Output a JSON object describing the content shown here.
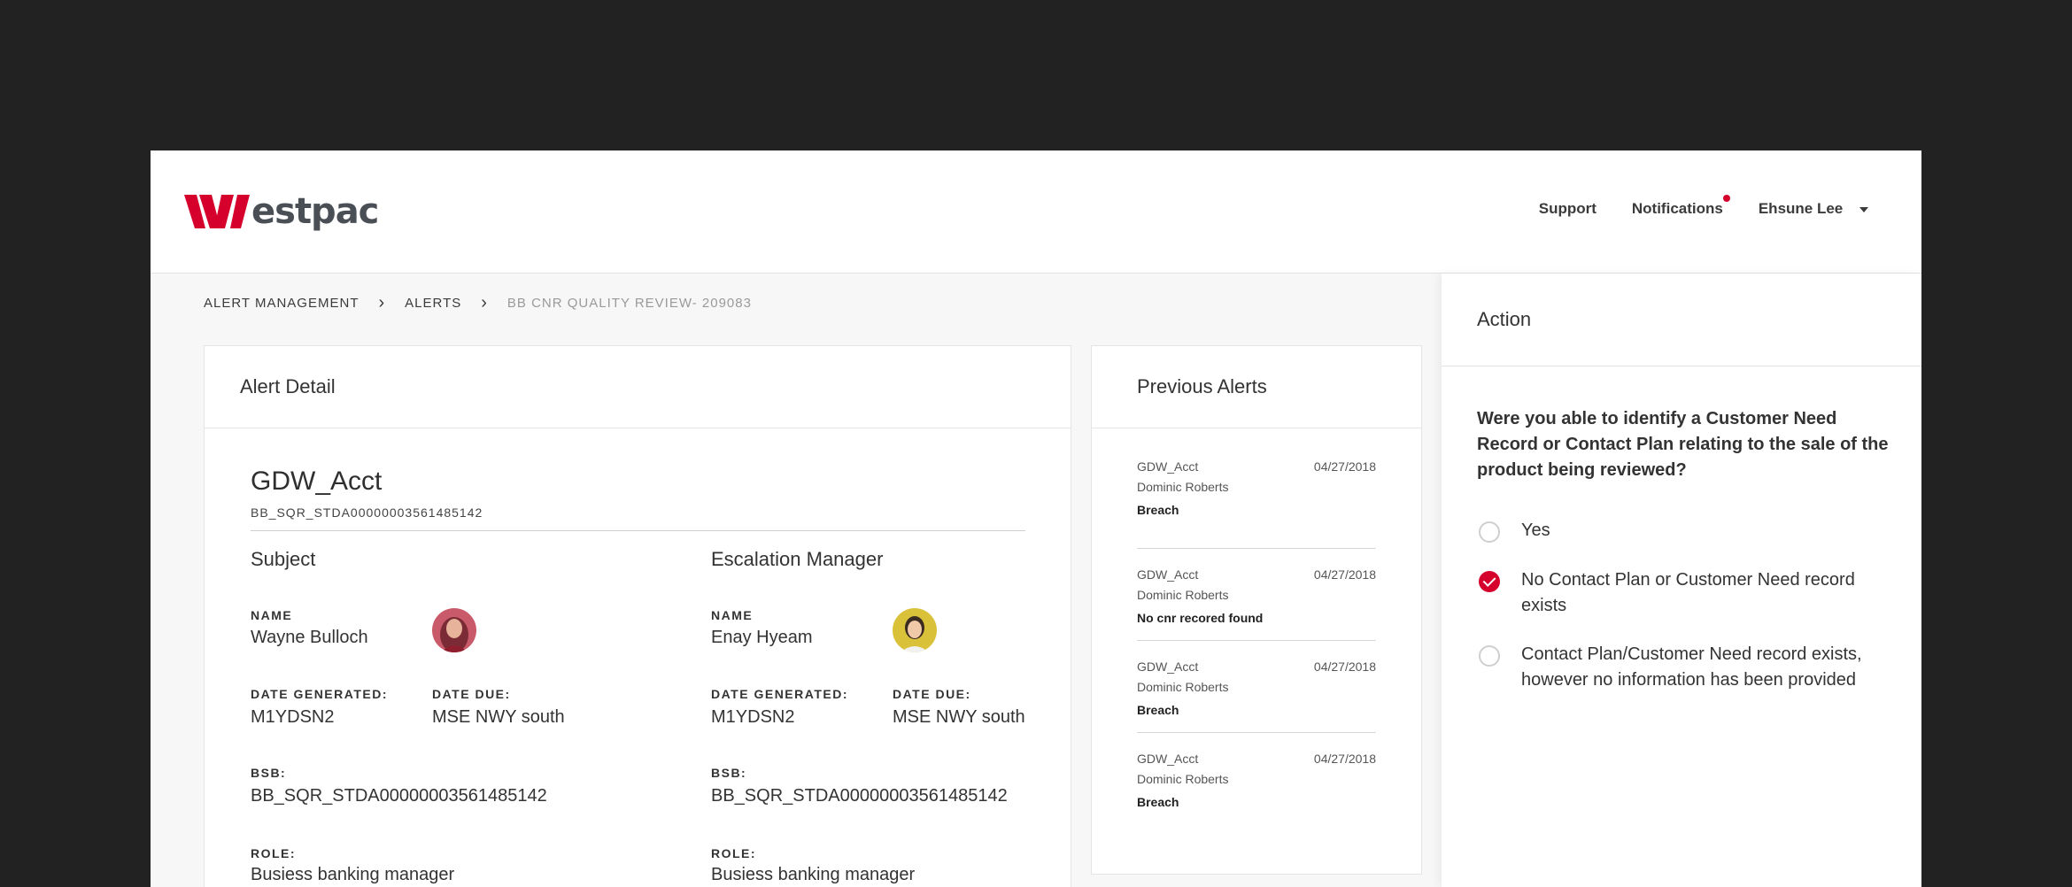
{
  "brand": {
    "name_text": "estpac",
    "accent_color": "#d5002b"
  },
  "nav": {
    "support": "Support",
    "notifications": "Notifications",
    "user": "Ehsune Lee"
  },
  "breadcrumb": {
    "items": [
      "ALERT MANAGEMENT",
      "ALERTS",
      "BB CNR QUALITY REVIEW- 209083"
    ]
  },
  "alert_detail": {
    "title": "Alert Detail",
    "account_name": "GDW_Acct",
    "account_code": "BB_SQR_STDA00000003561485142",
    "subject": {
      "heading": "Subject",
      "name_label": "NAME",
      "name": "Wayne Bulloch",
      "date_generated_label": "DATE GENERATED:",
      "date_generated": "M1YDSN2",
      "date_due_label": "DATE DUE:",
      "date_due": "MSE NWY south",
      "bsb_label": "BSB:",
      "bsb": "BB_SQR_STDA00000003561485142",
      "role_label": "ROLE:",
      "role": "Busiess banking manager"
    },
    "escalation": {
      "heading": "Escalation Manager",
      "name_label": "NAME",
      "name": "Enay Hyeam",
      "date_generated_label": "DATE GENERATED:",
      "date_generated": "M1YDSN2",
      "date_due_label": "DATE DUE:",
      "date_due": "MSE NWY south",
      "bsb_label": "BSB:",
      "bsb": "BB_SQR_STDA00000003561485142",
      "role_label": "ROLE:",
      "role": "Busiess banking manager"
    }
  },
  "previous_alerts": {
    "title": "Previous Alerts",
    "items": [
      {
        "account": "GDW_Acct",
        "name": "Dominic Roberts",
        "status": "Breach",
        "date": "04/27/2018"
      },
      {
        "account": "GDW_Acct",
        "name": "Dominic Roberts",
        "status": "No cnr recored found",
        "date": "04/27/2018"
      },
      {
        "account": "GDW_Acct",
        "name": "Dominic Roberts",
        "status": "Breach",
        "date": "04/27/2018"
      },
      {
        "account": "GDW_Acct",
        "name": "Dominic Roberts",
        "status": "Breach",
        "date": "04/27/2018"
      }
    ]
  },
  "action": {
    "title": "Action",
    "question": "Were you able to identify a Customer Need Record or Contact Plan relating to the sale of the product being reviewed?",
    "options": [
      {
        "label": "Yes",
        "selected": false
      },
      {
        "label": "No Contact Plan or Customer Need record exists",
        "selected": true
      },
      {
        "label": "Contact Plan/Customer Need record exists, however no information has been provided",
        "selected": false
      }
    ]
  }
}
